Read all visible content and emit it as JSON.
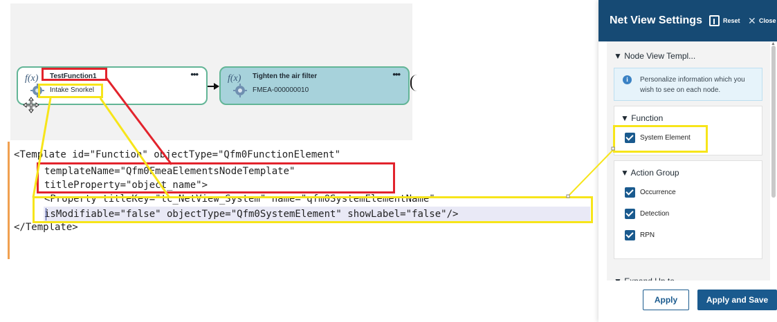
{
  "canvas": {
    "node1": {
      "title": "TestFunction1",
      "subtitle": "Intake Snorkel",
      "more": "•••",
      "icon": "function-node-icon"
    },
    "node2": {
      "title": "Tighten the air filter",
      "subtitle": "FMEA-000000010",
      "more": "•••",
      "icon": "function-node-icon"
    }
  },
  "code": {
    "line1": "<Template id=\"Function\" objectType=\"Qfm0FunctionElement\"",
    "line2": "templateName=\"Qfm0FmeaElementsNodeTemplate\"",
    "line3": "titleProperty=\"object_name\">",
    "line4": "<Property titleKey=\"tc_NetView_System\" name=\"qfm0SystemElementName\"",
    "line5": "isModifiable=\"false\" objectType=\"Qfm0SystemElement\" showLabel=\"false\"/>",
    "line6": "</Template>"
  },
  "panel": {
    "title": "Net View Settings",
    "reset_label": "Reset",
    "close_label": "Close",
    "node_view_section": "▼ Node View Templ...",
    "info_text": "Personalize information which you wish to see on each node.",
    "function_group": {
      "title": "▼ Function",
      "items": [
        {
          "label": "System Element",
          "checked": true
        }
      ]
    },
    "action_group": {
      "title": "▼ Action Group",
      "items": [
        {
          "label": "Occurrence",
          "checked": true
        },
        {
          "label": "Detection",
          "checked": true
        },
        {
          "label": "RPN",
          "checked": true
        }
      ]
    },
    "expand_section": "▼ Expand Up to",
    "apply_label": "Apply",
    "apply_save_label": "Apply and Save"
  },
  "colors": {
    "annotation_red": "#e2232c",
    "annotation_yellow": "#f7e51a",
    "panel_header": "#164a74",
    "primary_button": "#1a5a8e",
    "node_border": "#62b596",
    "node_selected_fill": "#a7d2db"
  }
}
